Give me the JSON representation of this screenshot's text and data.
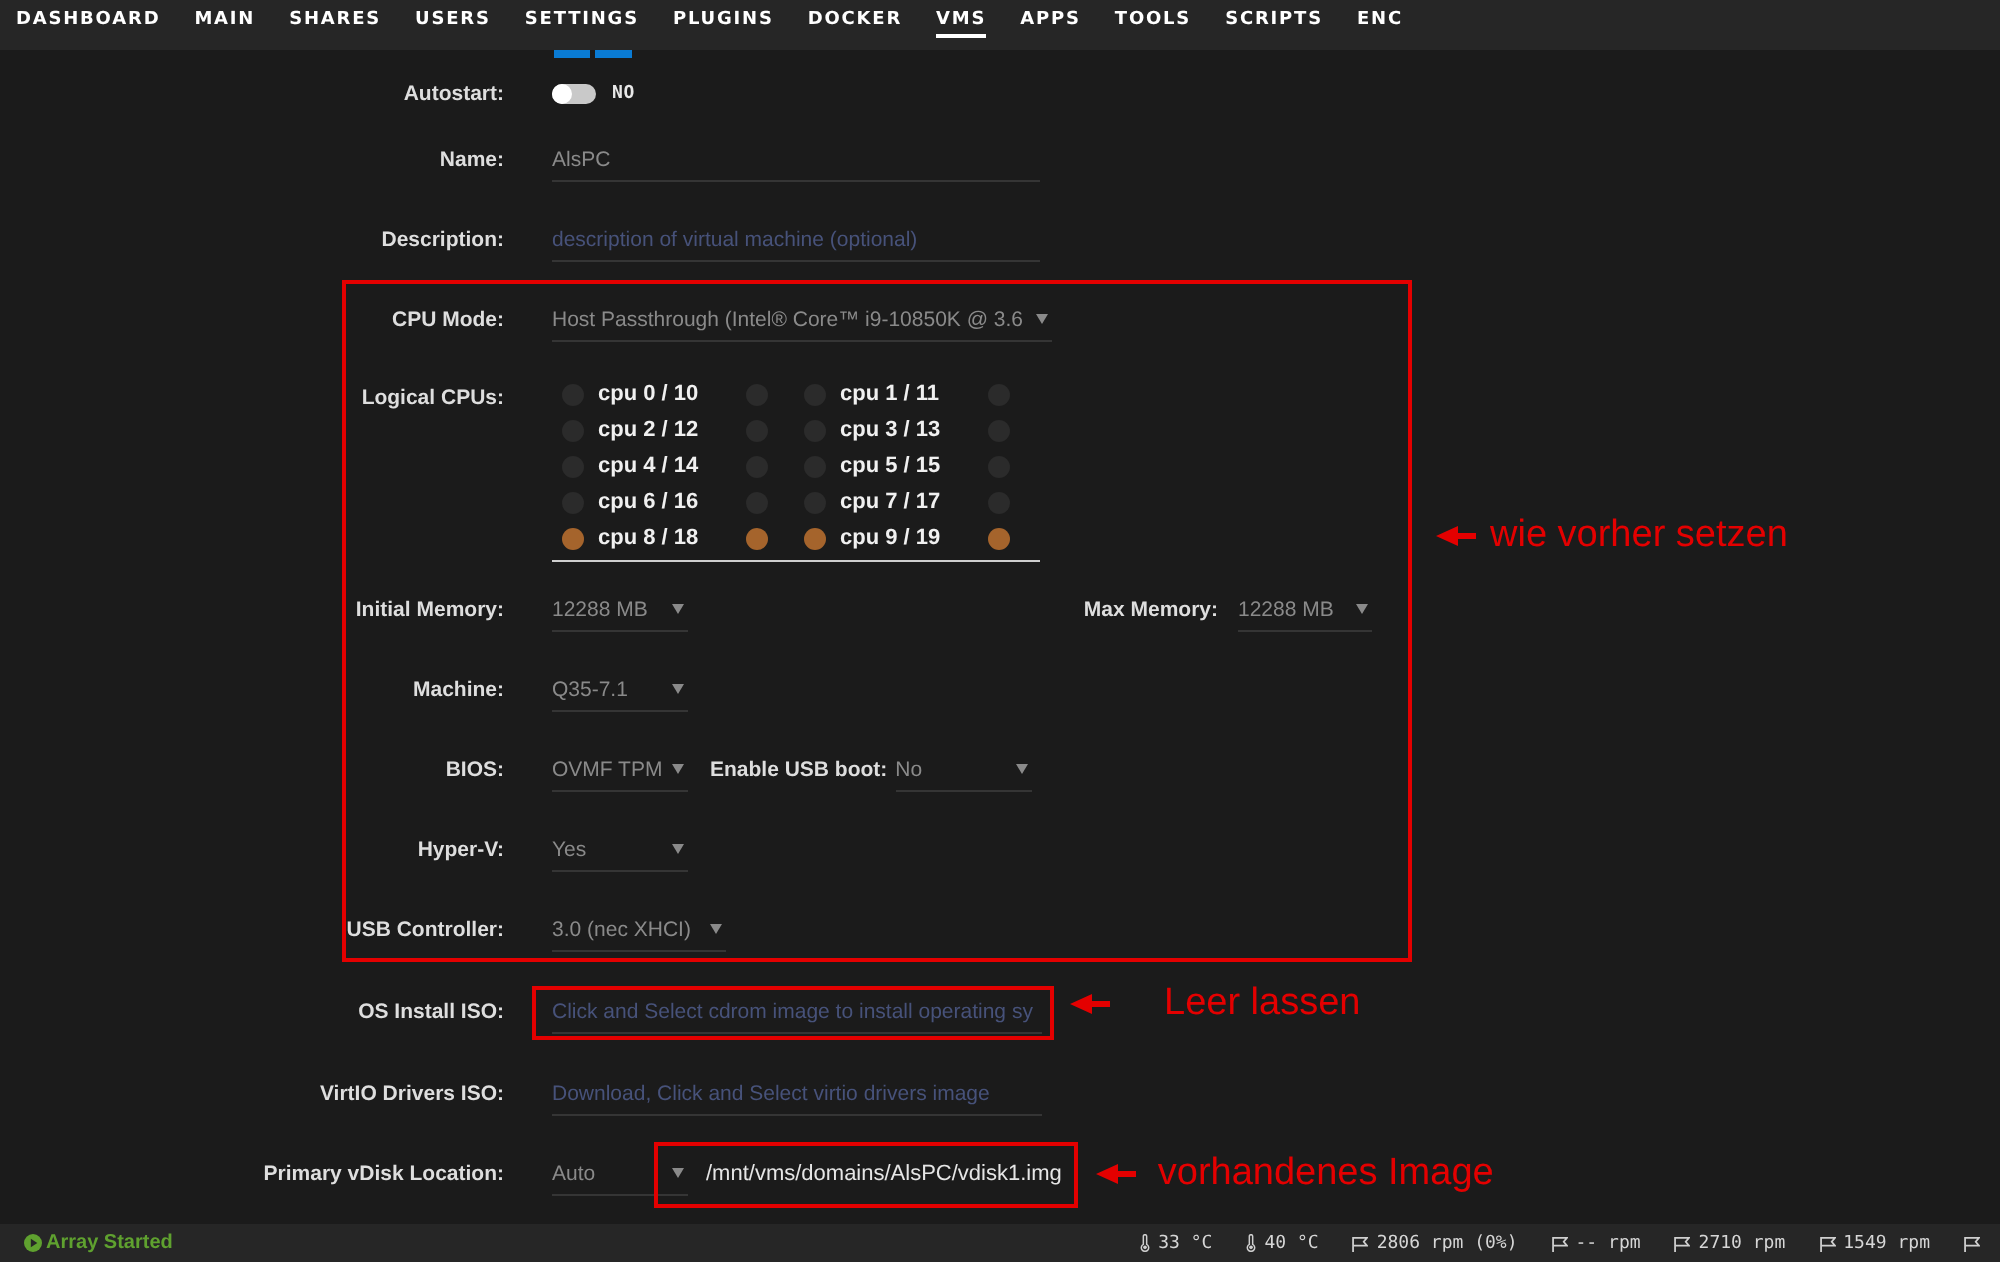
{
  "nav": {
    "tabs": [
      {
        "label": "DASHBOARD",
        "selected": false
      },
      {
        "label": "MAIN",
        "selected": false
      },
      {
        "label": "SHARES",
        "selected": false
      },
      {
        "label": "USERS",
        "selected": false
      },
      {
        "label": "SETTINGS",
        "selected": false
      },
      {
        "label": "PLUGINS",
        "selected": false
      },
      {
        "label": "DOCKER",
        "selected": false
      },
      {
        "label": "VMS",
        "selected": true
      },
      {
        "label": "APPS",
        "selected": false
      },
      {
        "label": "TOOLS",
        "selected": false
      },
      {
        "label": "SCRIPTS",
        "selected": false
      },
      {
        "label": "ENC",
        "selected": false
      }
    ]
  },
  "form": {
    "autostart": {
      "label": "Autostart:",
      "on": false,
      "state_text": "NO"
    },
    "name": {
      "label": "Name:",
      "value": "AlsPC"
    },
    "description": {
      "label": "Description:",
      "placeholder": "description of virtual machine (optional)"
    },
    "cpu_section": {
      "annotation": "wie vorher setzen",
      "cpu_mode": {
        "label": "CPU Mode:",
        "value": "Host Passthrough (Intel® Core™ i9-10850K @ 3.6"
      },
      "logical_cpus": {
        "label": "Logical CPUs:",
        "pairs": [
          {
            "label": "cpu 0 / 10",
            "threads": [
              {
                "checked": false
              },
              {
                "checked": false
              }
            ]
          },
          {
            "label": "cpu 1 / 11",
            "threads": [
              {
                "checked": false
              },
              {
                "checked": false
              }
            ]
          },
          {
            "label": "cpu 2 / 12",
            "threads": [
              {
                "checked": false
              },
              {
                "checked": false
              }
            ]
          },
          {
            "label": "cpu 3 / 13",
            "threads": [
              {
                "checked": false
              },
              {
                "checked": false
              }
            ]
          },
          {
            "label": "cpu 4 / 14",
            "threads": [
              {
                "checked": false
              },
              {
                "checked": false
              }
            ]
          },
          {
            "label": "cpu 5 / 15",
            "threads": [
              {
                "checked": false
              },
              {
                "checked": false
              }
            ]
          },
          {
            "label": "cpu 6 / 16",
            "threads": [
              {
                "checked": false
              },
              {
                "checked": false
              }
            ]
          },
          {
            "label": "cpu 7 / 17",
            "threads": [
              {
                "checked": false
              },
              {
                "checked": false
              }
            ]
          },
          {
            "label": "cpu 8 / 18",
            "threads": [
              {
                "checked": true
              },
              {
                "checked": true
              }
            ]
          },
          {
            "label": "cpu 9 / 19",
            "threads": [
              {
                "checked": true
              },
              {
                "checked": true
              }
            ]
          }
        ]
      },
      "initial_memory": {
        "label": "Initial Memory:",
        "value": "12288 MB"
      },
      "max_memory": {
        "label": "Max Memory:",
        "value": "12288 MB"
      },
      "machine": {
        "label": "Machine:",
        "value": "Q35-7.1"
      },
      "bios": {
        "label": "BIOS:",
        "value": "OVMF TPM"
      },
      "usb_boot": {
        "label": "Enable USB boot:",
        "value": "No"
      },
      "hyper_v": {
        "label": "Hyper-V:",
        "value": "Yes"
      },
      "usb_controller": {
        "label": "USB Controller:",
        "value": "3.0 (nec XHCI)"
      }
    },
    "os_install_iso": {
      "label": "OS Install ISO:",
      "placeholder": "Click and Select cdrom image to install operating sy",
      "annotation": "Leer lassen"
    },
    "virtio_iso": {
      "label": "VirtIO Drivers ISO:",
      "placeholder": "Download, Click and Select virtio drivers image"
    },
    "primary_vdisk": {
      "label": "Primary vDisk Location:",
      "location": "Auto",
      "path": "/mnt/vms/domains/AlsPC/vdisk1.img",
      "annotation": "vorhandenes Image"
    }
  },
  "status_bar": {
    "array_status": "Array Started",
    "readings": [
      {
        "kind": "temperature",
        "text": "33 °C"
      },
      {
        "kind": "temperature",
        "text": "40 °C"
      },
      {
        "kind": "fan",
        "text": "2806 rpm (0%)"
      },
      {
        "kind": "fan",
        "text": "-- rpm"
      },
      {
        "kind": "fan",
        "text": "2710 rpm"
      },
      {
        "kind": "fan",
        "text": "1549 rpm"
      },
      {
        "kind": "fan"
      }
    ]
  }
}
